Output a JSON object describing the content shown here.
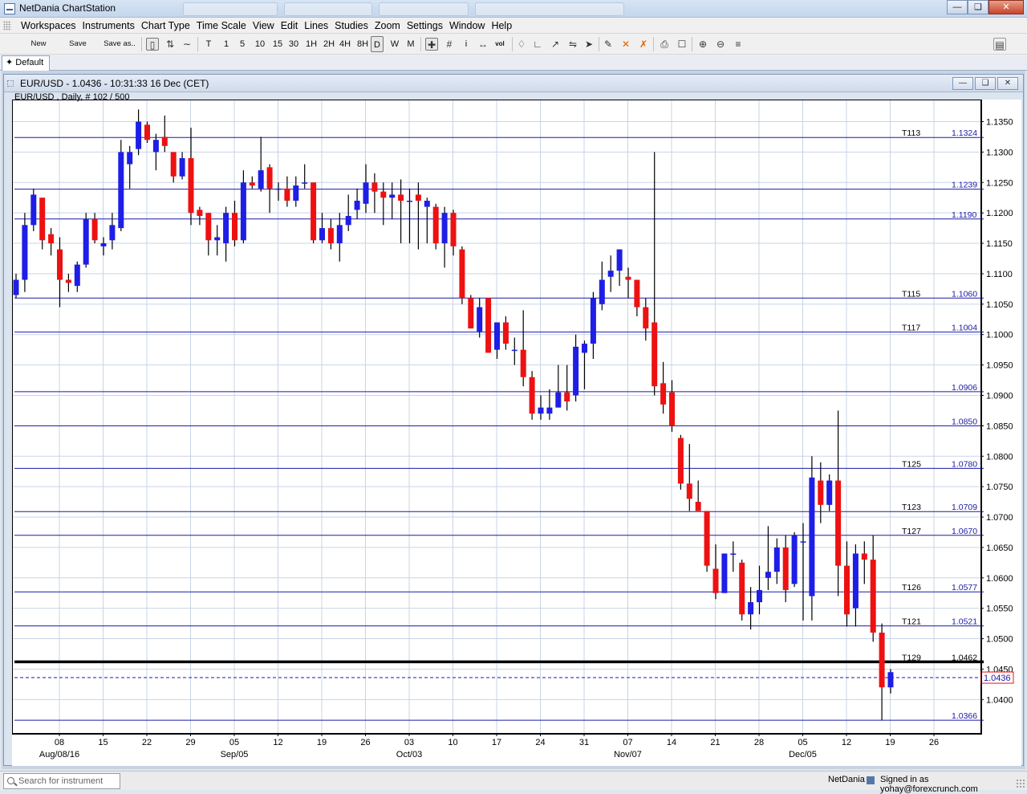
{
  "app": {
    "title": "NetDania ChartStation"
  },
  "menu": [
    "Workspaces",
    "Instruments",
    "Chart Type",
    "Time Scale",
    "View",
    "Edit",
    "Lines",
    "Studies",
    "Zoom",
    "Settings",
    "Window",
    "Help"
  ],
  "toolbar": {
    "new_label": "New",
    "save_label": "Save",
    "saveas_label": "Save as..",
    "timeframes": [
      "T",
      "1",
      "5",
      "10",
      "15",
      "30",
      "1H",
      "2H",
      "4H",
      "8H",
      "D",
      "W",
      "M"
    ],
    "active_timeframe": "D",
    "info_label": "i",
    "vol_label": "vol"
  },
  "tab": {
    "label": "Default"
  },
  "chart_window": {
    "title": "EUR/USD - 1.0436 - 10:31:33  16 Dec (CET)"
  },
  "colors": {
    "up": "#1e1ee6",
    "down": "#ee1111",
    "level": "#1a1aa8",
    "support": "#000000",
    "price": "#1a1aa8"
  },
  "chart_data": {
    "type": "candlestick",
    "instrument": "EUR/USD",
    "header": "EUR/USD , Daily, # 102 / 500",
    "timeframe": "Daily",
    "ylim": [
      1.0345,
      1.1385
    ],
    "y_ticks": [
      "1.1350",
      "1.1300",
      "1.1250",
      "1.1200",
      "1.1150",
      "1.1100",
      "1.1050",
      "1.1000",
      "1.0950",
      "1.0900",
      "1.0850",
      "1.0800",
      "1.0750",
      "1.0700",
      "1.0650",
      "1.0600",
      "1.0550",
      "1.0500",
      "1.0450",
      "1.0400"
    ],
    "x_ticks": [
      "08",
      "15",
      "22",
      "29",
      "05",
      "12",
      "19",
      "26",
      "03",
      "10",
      "17",
      "24",
      "31",
      "07",
      "14",
      "21",
      "28",
      "05",
      "12",
      "19",
      "26"
    ],
    "x_months": [
      "Aug/08/16",
      "Sep/05",
      "Oct/03",
      "Nov/07",
      "Dec/05"
    ],
    "current_price": "1.0436",
    "levels": [
      {
        "tag": "T113",
        "label": "1.1324",
        "value": 1.1324
      },
      {
        "tag": "",
        "label": "1.1239",
        "value": 1.1239
      },
      {
        "tag": "",
        "label": "1.1190",
        "value": 1.119
      },
      {
        "tag": "T115",
        "label": "1.1060",
        "value": 1.106
      },
      {
        "tag": "T117",
        "label": "1.1004",
        "value": 1.1004
      },
      {
        "tag": "",
        "label": "1.0906",
        "value": 1.0906
      },
      {
        "tag": "",
        "label": "1.0850",
        "value": 1.085
      },
      {
        "tag": "T125",
        "label": "1.0780",
        "value": 1.078
      },
      {
        "tag": "T123",
        "label": "1.0709",
        "value": 1.0709
      },
      {
        "tag": "T127",
        "label": "1.0670",
        "value": 1.067
      },
      {
        "tag": "T126",
        "label": "1.0577",
        "value": 1.0577
      },
      {
        "tag": "T121",
        "label": "1.0521",
        "value": 1.0521
      },
      {
        "tag": "T129",
        "label": "1.0462",
        "value": 1.0462,
        "bold": true
      },
      {
        "tag": "",
        "label": "1.0366",
        "value": 1.0366
      }
    ],
    "candles": [
      [
        1.1065,
        1.11,
        1.106,
        1.109
      ],
      [
        1.109,
        1.12,
        1.107,
        1.118
      ],
      [
        1.118,
        1.124,
        1.117,
        1.123
      ],
      [
        1.1225,
        1.1225,
        1.114,
        1.1155
      ],
      [
        1.1165,
        1.1175,
        1.113,
        1.115
      ],
      [
        1.114,
        1.116,
        1.1045,
        1.109
      ],
      [
        1.109,
        1.11,
        1.107,
        1.1085
      ],
      [
        1.108,
        1.112,
        1.107,
        1.1115
      ],
      [
        1.1115,
        1.12,
        1.111,
        1.119
      ],
      [
        1.119,
        1.12,
        1.115,
        1.1155
      ],
      [
        1.1145,
        1.116,
        1.113,
        1.115
      ],
      [
        1.1155,
        1.12,
        1.114,
        1.118
      ],
      [
        1.1175,
        1.132,
        1.117,
        1.13
      ],
      [
        1.128,
        1.131,
        1.124,
        1.13
      ],
      [
        1.1305,
        1.137,
        1.1295,
        1.135
      ],
      [
        1.1345,
        1.135,
        1.1315,
        1.132
      ],
      [
        1.13,
        1.133,
        1.127,
        1.132
      ],
      [
        1.1325,
        1.136,
        1.13,
        1.131
      ],
      [
        1.13,
        1.13,
        1.125,
        1.126
      ],
      [
        1.126,
        1.13,
        1.1255,
        1.129
      ],
      [
        1.129,
        1.134,
        1.118,
        1.12
      ],
      [
        1.1205,
        1.121,
        1.118,
        1.1195
      ],
      [
        1.12,
        1.12,
        1.113,
        1.1155
      ],
      [
        1.1155,
        1.118,
        1.113,
        1.116
      ],
      [
        1.115,
        1.121,
        1.112,
        1.12
      ],
      [
        1.12,
        1.122,
        1.1145,
        1.1155
      ],
      [
        1.1155,
        1.127,
        1.115,
        1.125
      ],
      [
        1.125,
        1.126,
        1.124,
        1.1245
      ],
      [
        1.124,
        1.1325,
        1.1235,
        1.127
      ],
      [
        1.1275,
        1.128,
        1.12,
        1.124
      ],
      [
        1.124,
        1.125,
        1.122,
        1.124
      ],
      [
        1.124,
        1.126,
        1.121,
        1.122
      ],
      [
        1.122,
        1.126,
        1.121,
        1.1245
      ],
      [
        1.125,
        1.128,
        1.124,
        1.125
      ],
      [
        1.125,
        1.125,
        1.115,
        1.1155
      ],
      [
        1.1155,
        1.12,
        1.115,
        1.1175
      ],
      [
        1.1175,
        1.119,
        1.114,
        1.115
      ],
      [
        1.115,
        1.12,
        1.112,
        1.118
      ],
      [
        1.118,
        1.123,
        1.117,
        1.1195
      ],
      [
        1.1205,
        1.124,
        1.119,
        1.122
      ],
      [
        1.1215,
        1.128,
        1.12,
        1.125
      ],
      [
        1.125,
        1.1265,
        1.12,
        1.1235
      ],
      [
        1.1235,
        1.125,
        1.118,
        1.1225
      ],
      [
        1.1225,
        1.125,
        1.119,
        1.123
      ],
      [
        1.123,
        1.1255,
        1.115,
        1.122
      ],
      [
        1.122,
        1.124,
        1.115,
        1.122
      ],
      [
        1.123,
        1.125,
        1.114,
        1.122
      ],
      [
        1.121,
        1.1225,
        1.115,
        1.122
      ],
      [
        1.121,
        1.1215,
        1.114,
        1.115
      ],
      [
        1.115,
        1.121,
        1.111,
        1.12
      ],
      [
        1.12,
        1.1205,
        1.113,
        1.1145
      ],
      [
        1.114,
        1.1145,
        1.105,
        1.106
      ],
      [
        1.106,
        1.1065,
        1.101,
        1.101
      ],
      [
        1.1005,
        1.106,
        1.0995,
        1.1045
      ],
      [
        1.106,
        1.106,
        1.097,
        1.097
      ],
      [
        1.0975,
        1.1015,
        1.096,
        1.102
      ],
      [
        1.102,
        1.103,
        1.0975,
        1.0985
      ],
      [
        1.0975,
        1.0995,
        1.095,
        1.0975
      ],
      [
        1.0975,
        1.104,
        1.0915,
        1.093
      ],
      [
        1.093,
        1.094,
        1.086,
        1.087
      ],
      [
        1.087,
        1.09,
        1.086,
        1.088
      ],
      [
        1.087,
        1.091,
        1.086,
        1.088
      ],
      [
        1.088,
        1.095,
        1.088,
        1.0905
      ],
      [
        1.0905,
        1.095,
        1.0875,
        1.089
      ],
      [
        1.09,
        1.1,
        1.089,
        1.098
      ],
      [
        1.097,
        1.099,
        1.091,
        1.0985
      ],
      [
        1.0985,
        1.107,
        1.096,
        1.106
      ],
      [
        1.105,
        1.112,
        1.104,
        1.109
      ],
      [
        1.1095,
        1.113,
        1.107,
        1.1105
      ],
      [
        1.1105,
        1.114,
        1.108,
        1.114
      ],
      [
        1.1095,
        1.111,
        1.106,
        1.109
      ],
      [
        1.109,
        1.109,
        1.103,
        1.1045
      ],
      [
        1.1045,
        1.106,
        1.099,
        1.101
      ],
      [
        1.102,
        1.13,
        1.09,
        1.0915
      ],
      [
        1.092,
        1.0955,
        1.087,
        1.0885
      ],
      [
        1.0905,
        1.0925,
        1.084,
        1.085
      ],
      [
        1.083,
        1.0835,
        1.0745,
        1.0755
      ],
      [
        1.0755,
        1.082,
        1.071,
        1.073
      ],
      [
        1.0725,
        1.076,
        1.071,
        1.071
      ],
      [
        1.071,
        1.071,
        1.061,
        1.062
      ],
      [
        1.0615,
        1.0655,
        1.0565,
        1.0575
      ],
      [
        1.0575,
        1.064,
        1.058,
        1.064
      ],
      [
        1.064,
        1.066,
        1.061,
        1.064
      ],
      [
        1.0625,
        1.063,
        1.053,
        1.054
      ],
      [
        1.054,
        1.0585,
        1.0515,
        1.056
      ],
      [
        1.056,
        1.062,
        1.054,
        1.058
      ],
      [
        1.06,
        1.0685,
        1.058,
        1.061
      ],
      [
        1.061,
        1.0665,
        1.059,
        1.065
      ],
      [
        1.065,
        1.067,
        1.056,
        1.058
      ],
      [
        1.059,
        1.0675,
        1.0585,
        1.067
      ],
      [
        1.066,
        1.069,
        1.053,
        1.066
      ],
      [
        1.057,
        1.08,
        1.053,
        1.0765
      ],
      [
        1.076,
        1.079,
        1.069,
        1.072
      ],
      [
        1.072,
        1.077,
        1.071,
        1.076
      ],
      [
        1.076,
        1.0875,
        1.057,
        1.062
      ],
      [
        1.062,
        1.066,
        1.052,
        1.054
      ],
      [
        1.055,
        1.0655,
        1.052,
        1.064
      ],
      [
        1.064,
        1.066,
        1.059,
        1.063
      ],
      [
        1.063,
        1.067,
        1.0495,
        1.051
      ],
      [
        1.051,
        1.0525,
        1.0366,
        1.042
      ],
      [
        1.042,
        1.045,
        1.041,
        1.0445
      ]
    ]
  },
  "status": {
    "search_placeholder": "Search for instrument",
    "brand": "NetDania",
    "signed_in": "Signed in as yohay@forexcrunch.com"
  }
}
